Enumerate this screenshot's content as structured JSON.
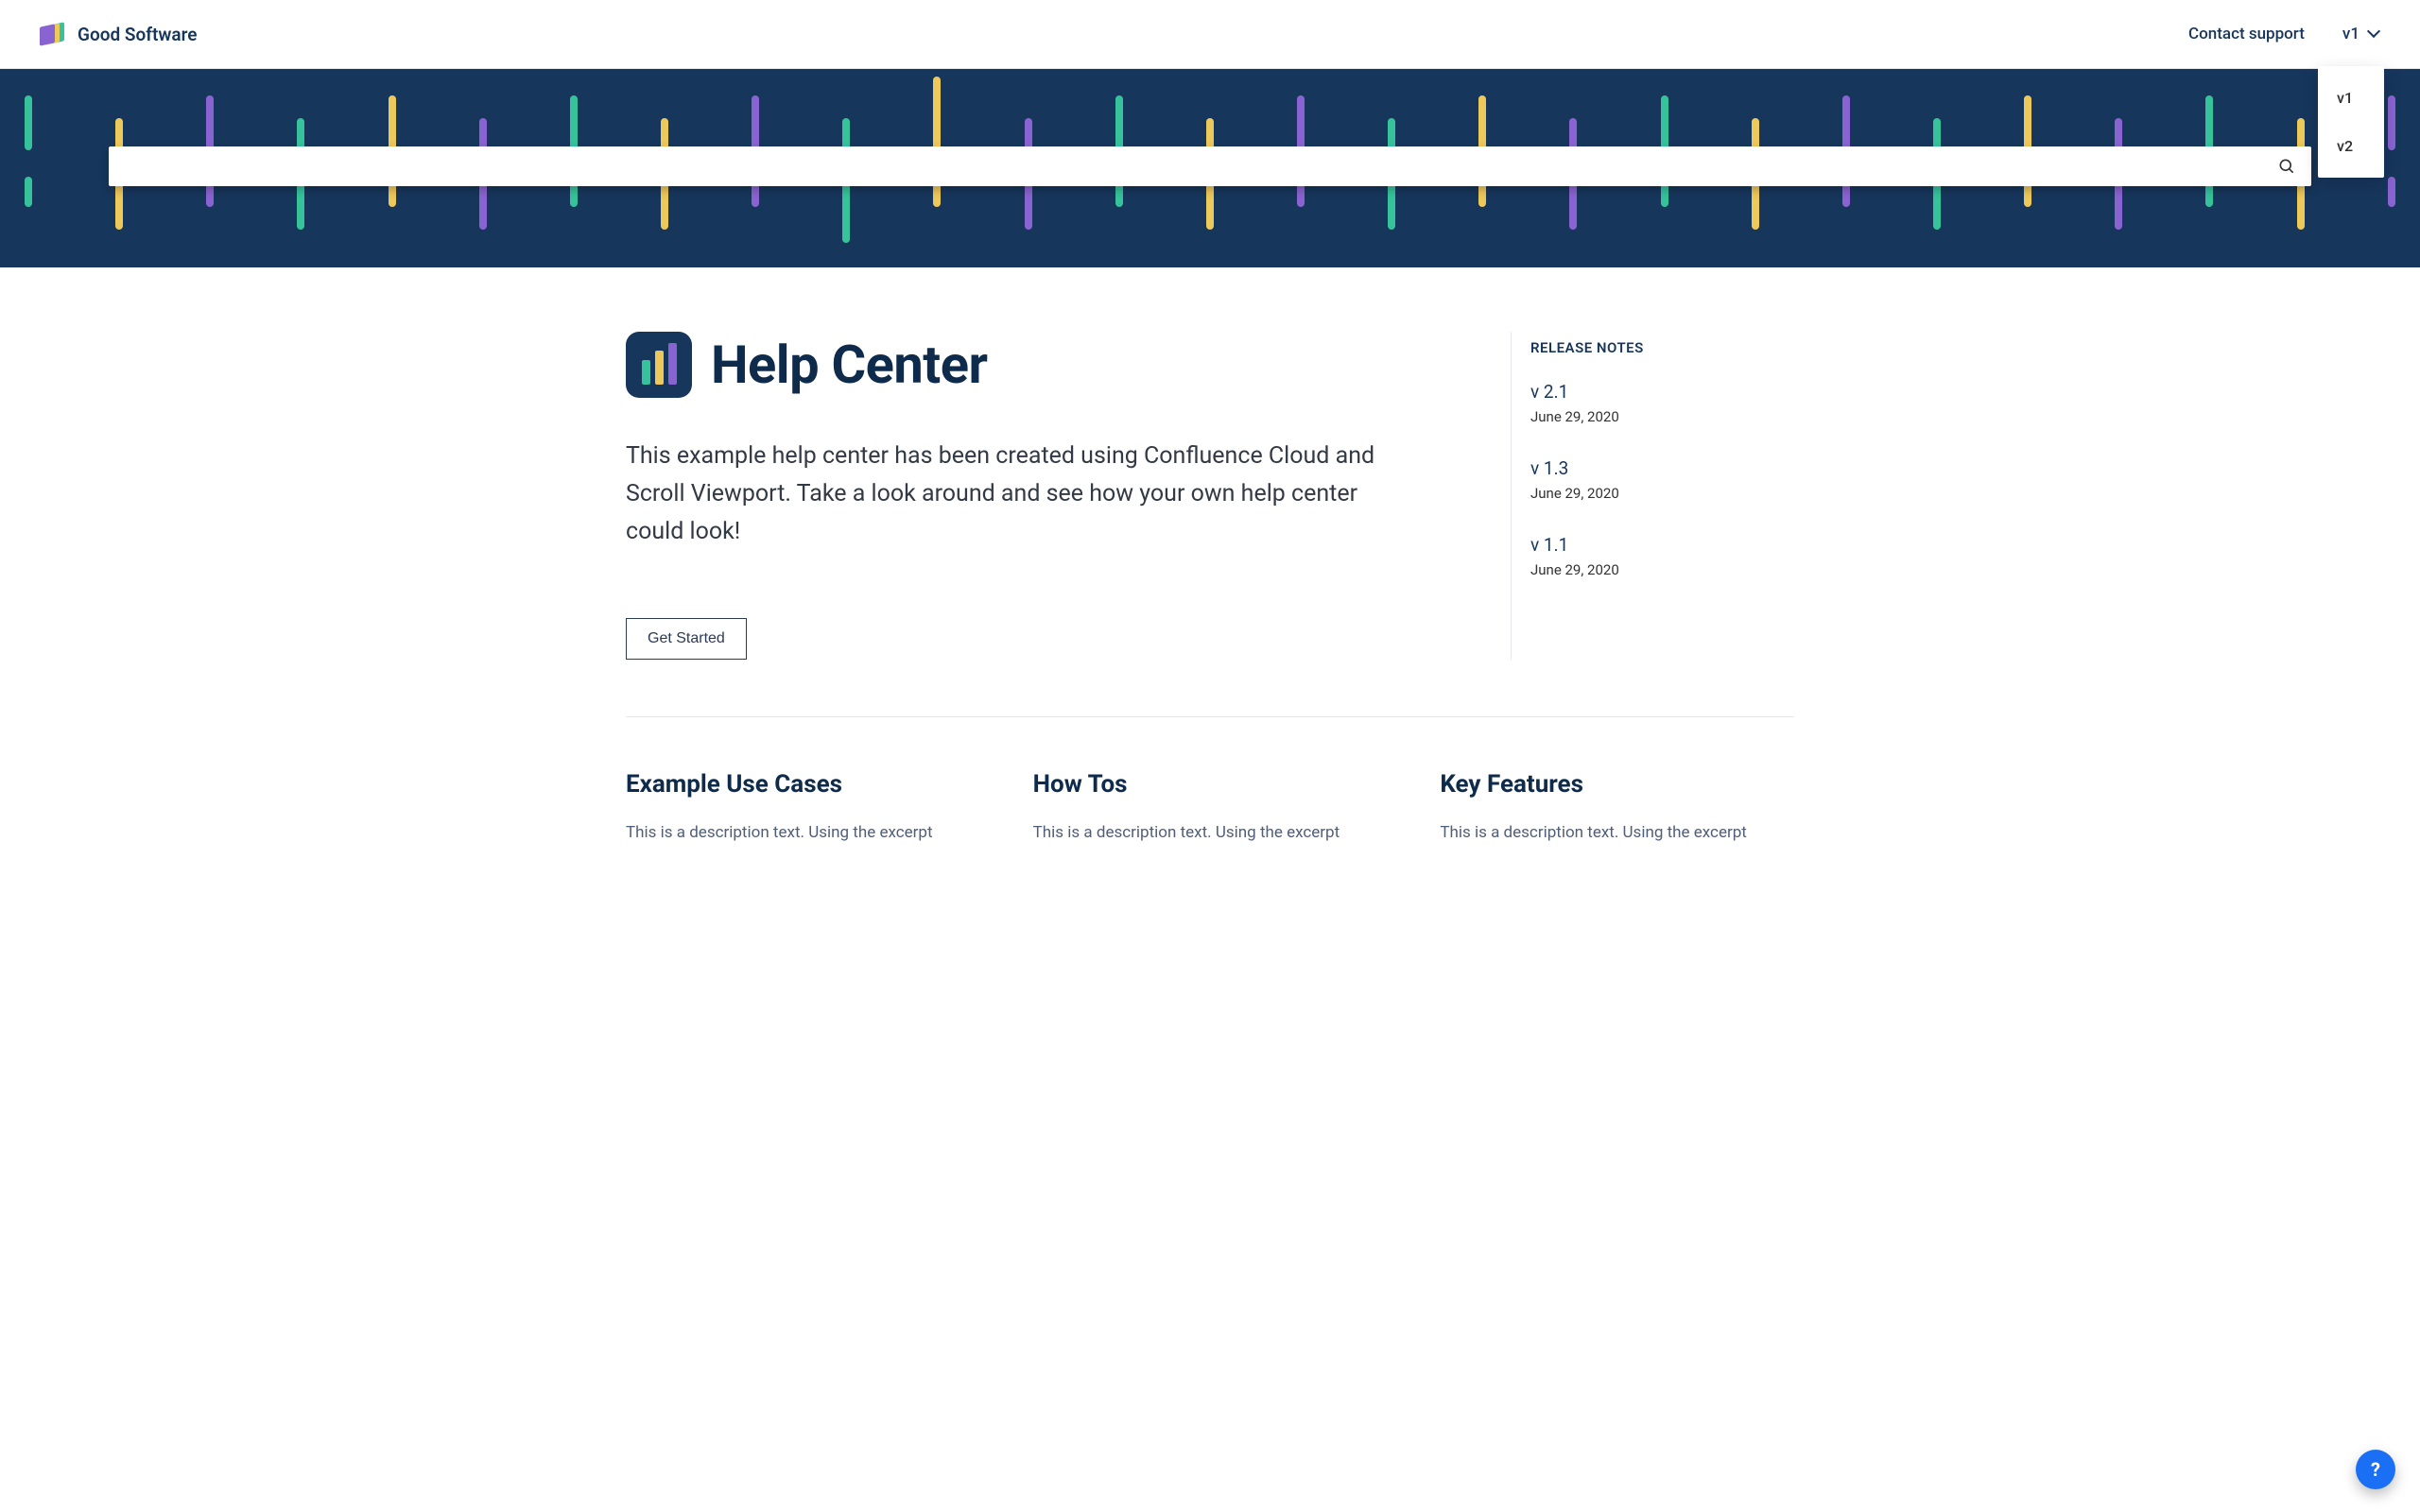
{
  "nav": {
    "brand": "Good Software",
    "contact": "Contact support",
    "version_selected": "v1",
    "version_options": [
      "v1",
      "v2"
    ]
  },
  "search": {
    "placeholder": ""
  },
  "hero": {
    "title": "Help Center",
    "intro": "This example help center has been created using Confluence Cloud and Scroll Viewport. Take a look around and see how your own help center could look!",
    "cta": "Get Started"
  },
  "release": {
    "heading": "RELEASE NOTES",
    "items": [
      {
        "version": "v 2.1",
        "date": "June 29, 2020"
      },
      {
        "version": "v 1.3",
        "date": "June 29, 2020"
      },
      {
        "version": "v 1.1",
        "date": "June 29, 2020"
      }
    ]
  },
  "cards": [
    {
      "title": "Example Use Cases",
      "desc": "This is a description text. Using the excerpt"
    },
    {
      "title": "How Tos",
      "desc": "This is a description text. Using the excerpt"
    },
    {
      "title": "Key Features",
      "desc": "This is a description text. Using the excerpt"
    }
  ],
  "help_fab": "?"
}
